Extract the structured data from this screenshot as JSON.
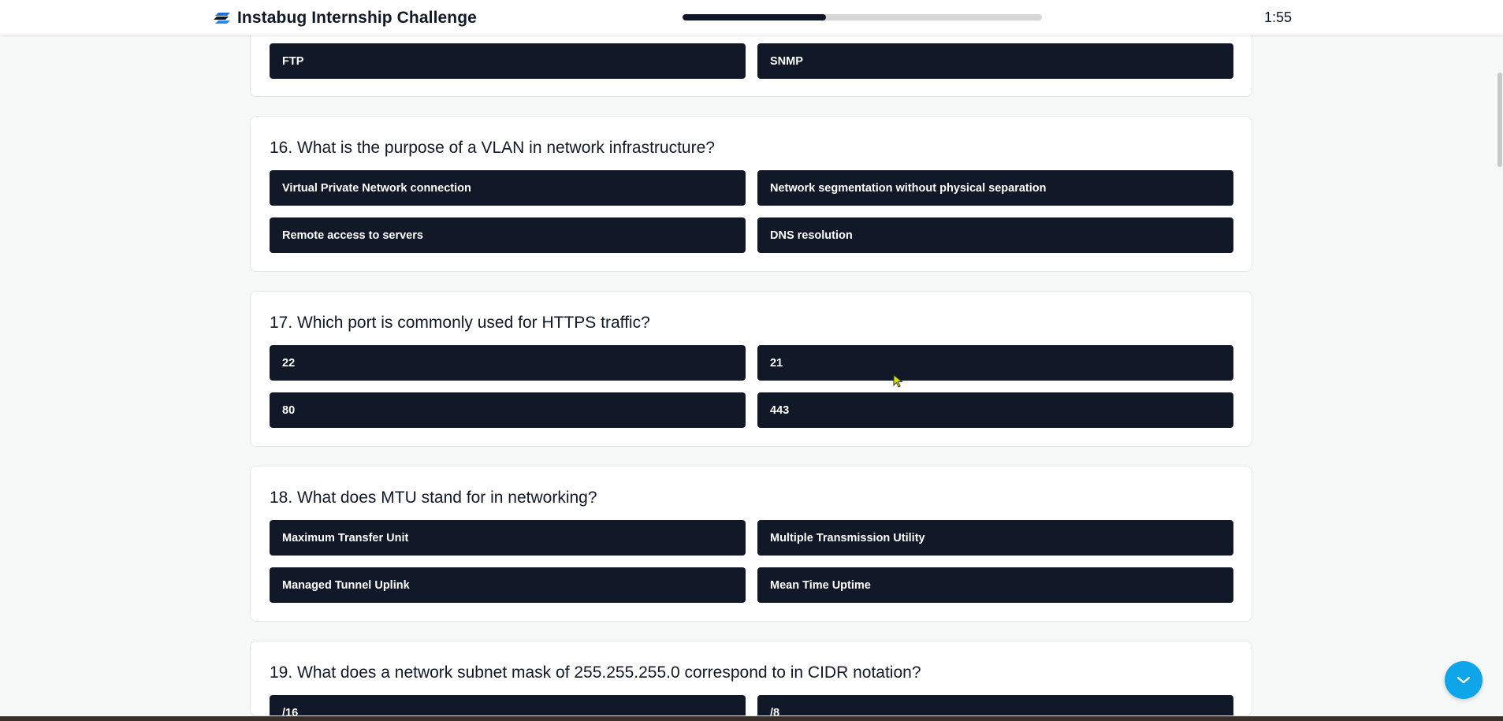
{
  "header": {
    "title": "Instabug Internship Challenge",
    "timer": "1:55",
    "progress_fraction": 0.4,
    "logo_icon": "instabug-logo-icon"
  },
  "questions": [
    {
      "title": "",
      "options": [
        "FTP",
        "SNMP"
      ]
    },
    {
      "title": "16. What is the purpose of a VLAN in network infrastructure?",
      "options": [
        "Virtual Private Network connection",
        "Network segmentation without physical separation",
        "Remote access to servers",
        "DNS resolution"
      ]
    },
    {
      "title": "17. Which port is commonly used for HTTPS traffic?",
      "options": [
        "22",
        "21",
        "80",
        "443"
      ]
    },
    {
      "title": "18. What does MTU stand for in networking?",
      "options": [
        "Maximum Transfer Unit",
        "Multiple Transmission Utility",
        "Managed Tunnel Uplink",
        "Mean Time Uptime"
      ]
    },
    {
      "title": "19. What does a network subnet mask of 255.255.255.0 correspond to in CIDR notation?",
      "options": [
        "/16",
        "/8"
      ]
    }
  ],
  "scroll_button": {
    "icon": "chevron-down-icon"
  },
  "colors": {
    "option_bg": "#111827",
    "accent": "#0ea5e9",
    "progress": "#0f1626"
  }
}
